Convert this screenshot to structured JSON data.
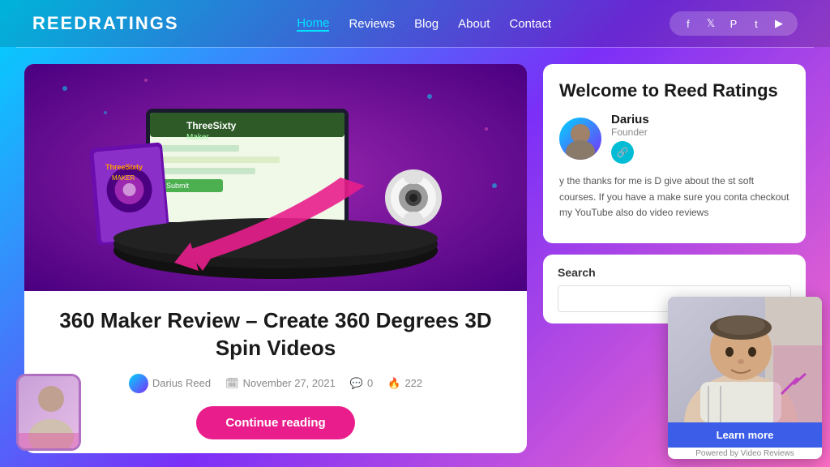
{
  "header": {
    "logo": "ReedRatings",
    "nav": {
      "items": [
        {
          "label": "Home",
          "active": true
        },
        {
          "label": "Reviews",
          "active": false
        },
        {
          "label": "Blog",
          "active": false
        },
        {
          "label": "About",
          "active": false
        },
        {
          "label": "Contact",
          "active": false
        }
      ]
    },
    "social": {
      "icons": [
        "f",
        "t",
        "p",
        "t",
        "yt"
      ]
    }
  },
  "article": {
    "title": "360 Maker Review – Create 360 Degrees 3D Spin Videos",
    "meta": {
      "author": "Darius Reed",
      "date": "November 27, 2021",
      "comments": "0",
      "views": "222"
    },
    "continue_btn": "Continue reading"
  },
  "sidebar": {
    "welcome": {
      "title": "Welcome to Reed Ratings",
      "founder_name": "Darius",
      "founder_role": "Founder",
      "description": "y the thanks for me is D give about the st soft courses. If you have a make sure you conta checkout my YouTube also do video reviews"
    },
    "search": {
      "label": "Search",
      "placeholder": ""
    }
  },
  "video_widget": {
    "learn_more_btn": "Learn more",
    "powered_by": "Powered by Video Reviews"
  },
  "icons": {
    "facebook": "f",
    "twitter": "𝕏",
    "pinterest": "P",
    "tumblr": "t",
    "youtube": "▶",
    "calendar": "🗓",
    "comment": "💬",
    "fire": "🔥",
    "link": "🔗"
  }
}
